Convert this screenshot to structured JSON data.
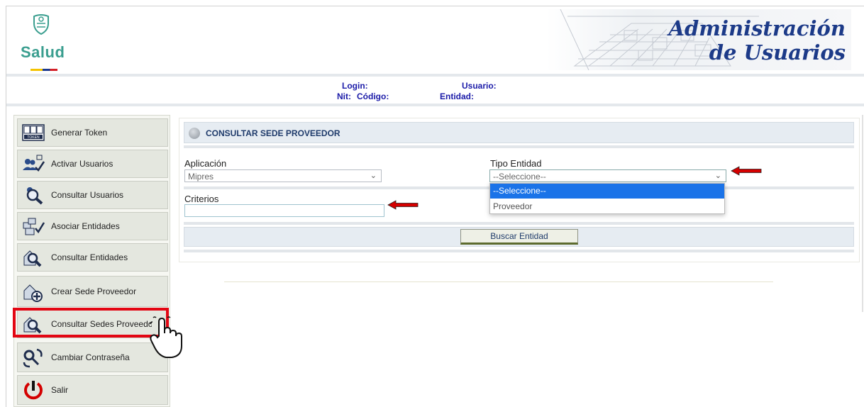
{
  "header": {
    "brand": "Salud",
    "banner_line1": "Administración",
    "banner_line2": "de Usuarios"
  },
  "info": {
    "login_label": "Login:",
    "usuario_label": "Usuario:",
    "nit_label": "Nit:",
    "codigo_label": "Código:",
    "entidad_label": "Entidad:"
  },
  "sidebar": {
    "items": [
      {
        "label": "Generar Token",
        "icon": "token-icon"
      },
      {
        "label": "Activar Usuarios",
        "icon": "users-check-icon"
      },
      {
        "label": "Consultar Usuarios",
        "icon": "user-search-icon"
      },
      {
        "label": "Asociar Entidades",
        "icon": "entities-check-icon"
      },
      {
        "label": "Consultar Entidades",
        "icon": "entities-search-icon"
      },
      {
        "label": "Crear Sede Proveedor",
        "icon": "add-site-icon"
      },
      {
        "label": "Consultar Sedes Proveedor",
        "icon": "site-search-icon"
      },
      {
        "label": "Cambiar Contraseña",
        "icon": "password-change-icon"
      },
      {
        "label": "Salir",
        "icon": "power-icon"
      }
    ],
    "highlighted": "Consultar Sedes Proveedor"
  },
  "main": {
    "title": "CONSULTAR SEDE PROVEEDOR",
    "aplicacion_label": "Aplicación",
    "aplicacion_value": "Mipres",
    "tipo_entidad_label": "Tipo Entidad",
    "tipo_entidad_value": "--Seleccione--",
    "tipo_entidad_options": [
      "--Seleccione--",
      "Proveedor"
    ],
    "criterios_label": "Criterios",
    "criterios_value": "",
    "search_button": "Buscar Entidad"
  },
  "colors": {
    "highlight": "#e30613",
    "dropdown_selected": "#1a73e8",
    "header_text": "#1c3a88"
  }
}
